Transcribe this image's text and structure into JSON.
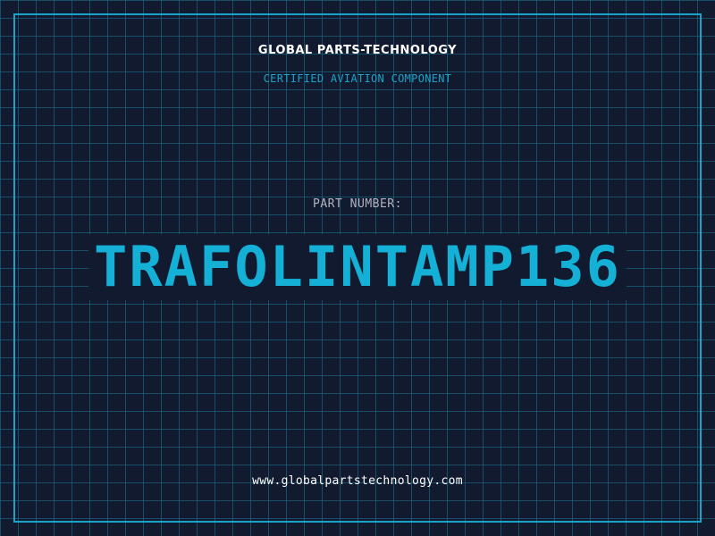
{
  "header": {
    "company": "GLOBAL PARTS-TECHNOLOGY",
    "tagline": "CERTIFIED AVIATION COMPONENT"
  },
  "part": {
    "label": "PART NUMBER:",
    "number": "TRAFOLINTAMP136"
  },
  "footer": {
    "website": "www.globalpartstechnology.com"
  },
  "colors": {
    "background": "#121a30",
    "grid": "#1e7896",
    "accent": "#1aa3c8",
    "part_number": "#14b0d6",
    "text_primary": "#ffffff",
    "text_muted": "#b0b4bf"
  }
}
